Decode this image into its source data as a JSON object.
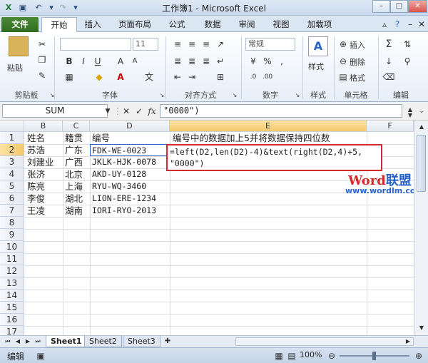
{
  "window": {
    "title": "工作簿1 - Microsoft Excel"
  },
  "quick_access": {
    "save_icon": "save-icon",
    "undo_icon": "undo-icon",
    "redo_icon": "redo-icon"
  },
  "ribbon": {
    "tabs": [
      "文件",
      "开始",
      "插入",
      "页面布局",
      "公式",
      "数据",
      "审阅",
      "视图",
      "加载项"
    ],
    "active_tab": "开始",
    "groups": {
      "clipboard": {
        "label": "剪贴板",
        "paste": "粘贴"
      },
      "font": {
        "label": "字体",
        "size": "11"
      },
      "alignment": {
        "label": "对齐方式"
      },
      "number": {
        "label": "数字",
        "format": "常规"
      },
      "styles": {
        "label": "样式",
        "button": "样式"
      },
      "cells": {
        "label": "单元格",
        "insert": "插入",
        "delete": "删除",
        "format": "格式"
      },
      "editing": {
        "label": "编辑"
      }
    }
  },
  "formula_bar": {
    "name_box": "SUM",
    "content": "\"0000\")"
  },
  "grid": {
    "columns": [
      "B",
      "C",
      "D",
      "E",
      "F"
    ],
    "rows": [
      "1",
      "2",
      "3",
      "4",
      "5",
      "6",
      "7",
      "8",
      "9",
      "10",
      "11",
      "12",
      "13",
      "14",
      "15",
      "16",
      "17"
    ],
    "cells": {
      "B1": "姓名",
      "C1": "籍贯",
      "D1": "编号",
      "E1": "编号中的数据加上5并将数据保持四位数",
      "B2": "苏浩",
      "C2": "广东",
      "D2": "FDK-WE-0023",
      "B3": "刘建业",
      "C3": "广西",
      "D3": "JKLK-HJK-0078",
      "B4": "张济",
      "C4": "北京",
      "D4": "AKD-UY-0128",
      "B5": "陈亮",
      "C5": "上海",
      "D5": "RYU-WQ-3460",
      "B6": "李俊",
      "C6": "湖北",
      "D6": "LION-ERE-1234",
      "B7": "王凌",
      "C7": "湖南",
      "D7": "IORI-RYO-2013"
    },
    "editing_formula_line1": "=left(D2,len(D2)-4)&text(right(D2,4)+5,",
    "editing_formula_line2": "\"0000\")"
  },
  "watermark": {
    "brand_word": "Word",
    "brand_cn": "联盟",
    "url": "www.wordlm.com"
  },
  "sheets": [
    "Sheet1",
    "Sheet2",
    "Sheet3"
  ],
  "status": {
    "mode": "编辑",
    "zoom": "100%"
  },
  "colors": {
    "file_tab": "#2f6e20",
    "highlight_border": "#d32b2b",
    "watermark_red": "#d32b2b",
    "watermark_blue": "#2a62c9"
  }
}
